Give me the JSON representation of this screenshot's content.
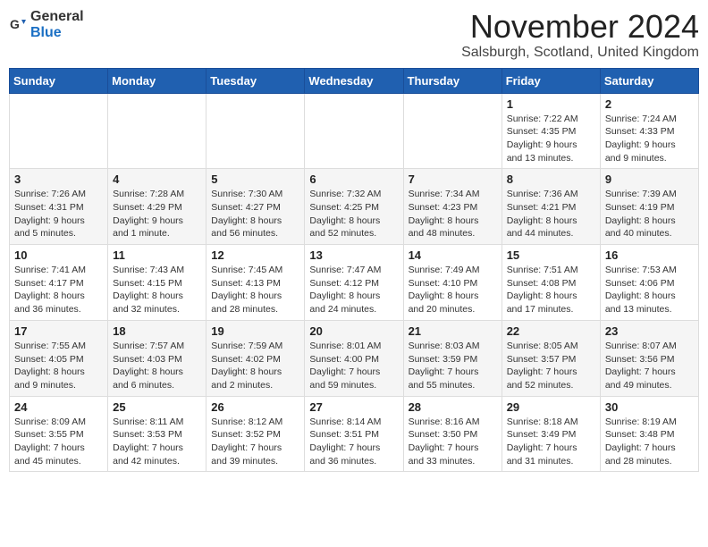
{
  "header": {
    "logo_general": "General",
    "logo_blue": "Blue",
    "month_title": "November 2024",
    "location": "Salsburgh, Scotland, United Kingdom"
  },
  "days_of_week": [
    "Sunday",
    "Monday",
    "Tuesday",
    "Wednesday",
    "Thursday",
    "Friday",
    "Saturday"
  ],
  "weeks": [
    [
      {
        "day": "",
        "info": ""
      },
      {
        "day": "",
        "info": ""
      },
      {
        "day": "",
        "info": ""
      },
      {
        "day": "",
        "info": ""
      },
      {
        "day": "",
        "info": ""
      },
      {
        "day": "1",
        "info": "Sunrise: 7:22 AM\nSunset: 4:35 PM\nDaylight: 9 hours and 13 minutes."
      },
      {
        "day": "2",
        "info": "Sunrise: 7:24 AM\nSunset: 4:33 PM\nDaylight: 9 hours and 9 minutes."
      }
    ],
    [
      {
        "day": "3",
        "info": "Sunrise: 7:26 AM\nSunset: 4:31 PM\nDaylight: 9 hours and 5 minutes."
      },
      {
        "day": "4",
        "info": "Sunrise: 7:28 AM\nSunset: 4:29 PM\nDaylight: 9 hours and 1 minute."
      },
      {
        "day": "5",
        "info": "Sunrise: 7:30 AM\nSunset: 4:27 PM\nDaylight: 8 hours and 56 minutes."
      },
      {
        "day": "6",
        "info": "Sunrise: 7:32 AM\nSunset: 4:25 PM\nDaylight: 8 hours and 52 minutes."
      },
      {
        "day": "7",
        "info": "Sunrise: 7:34 AM\nSunset: 4:23 PM\nDaylight: 8 hours and 48 minutes."
      },
      {
        "day": "8",
        "info": "Sunrise: 7:36 AM\nSunset: 4:21 PM\nDaylight: 8 hours and 44 minutes."
      },
      {
        "day": "9",
        "info": "Sunrise: 7:39 AM\nSunset: 4:19 PM\nDaylight: 8 hours and 40 minutes."
      }
    ],
    [
      {
        "day": "10",
        "info": "Sunrise: 7:41 AM\nSunset: 4:17 PM\nDaylight: 8 hours and 36 minutes."
      },
      {
        "day": "11",
        "info": "Sunrise: 7:43 AM\nSunset: 4:15 PM\nDaylight: 8 hours and 32 minutes."
      },
      {
        "day": "12",
        "info": "Sunrise: 7:45 AM\nSunset: 4:13 PM\nDaylight: 8 hours and 28 minutes."
      },
      {
        "day": "13",
        "info": "Sunrise: 7:47 AM\nSunset: 4:12 PM\nDaylight: 8 hours and 24 minutes."
      },
      {
        "day": "14",
        "info": "Sunrise: 7:49 AM\nSunset: 4:10 PM\nDaylight: 8 hours and 20 minutes."
      },
      {
        "day": "15",
        "info": "Sunrise: 7:51 AM\nSunset: 4:08 PM\nDaylight: 8 hours and 17 minutes."
      },
      {
        "day": "16",
        "info": "Sunrise: 7:53 AM\nSunset: 4:06 PM\nDaylight: 8 hours and 13 minutes."
      }
    ],
    [
      {
        "day": "17",
        "info": "Sunrise: 7:55 AM\nSunset: 4:05 PM\nDaylight: 8 hours and 9 minutes."
      },
      {
        "day": "18",
        "info": "Sunrise: 7:57 AM\nSunset: 4:03 PM\nDaylight: 8 hours and 6 minutes."
      },
      {
        "day": "19",
        "info": "Sunrise: 7:59 AM\nSunset: 4:02 PM\nDaylight: 8 hours and 2 minutes."
      },
      {
        "day": "20",
        "info": "Sunrise: 8:01 AM\nSunset: 4:00 PM\nDaylight: 7 hours and 59 minutes."
      },
      {
        "day": "21",
        "info": "Sunrise: 8:03 AM\nSunset: 3:59 PM\nDaylight: 7 hours and 55 minutes."
      },
      {
        "day": "22",
        "info": "Sunrise: 8:05 AM\nSunset: 3:57 PM\nDaylight: 7 hours and 52 minutes."
      },
      {
        "day": "23",
        "info": "Sunrise: 8:07 AM\nSunset: 3:56 PM\nDaylight: 7 hours and 49 minutes."
      }
    ],
    [
      {
        "day": "24",
        "info": "Sunrise: 8:09 AM\nSunset: 3:55 PM\nDaylight: 7 hours and 45 minutes."
      },
      {
        "day": "25",
        "info": "Sunrise: 8:11 AM\nSunset: 3:53 PM\nDaylight: 7 hours and 42 minutes."
      },
      {
        "day": "26",
        "info": "Sunrise: 8:12 AM\nSunset: 3:52 PM\nDaylight: 7 hours and 39 minutes."
      },
      {
        "day": "27",
        "info": "Sunrise: 8:14 AM\nSunset: 3:51 PM\nDaylight: 7 hours and 36 minutes."
      },
      {
        "day": "28",
        "info": "Sunrise: 8:16 AM\nSunset: 3:50 PM\nDaylight: 7 hours and 33 minutes."
      },
      {
        "day": "29",
        "info": "Sunrise: 8:18 AM\nSunset: 3:49 PM\nDaylight: 7 hours and 31 minutes."
      },
      {
        "day": "30",
        "info": "Sunrise: 8:19 AM\nSunset: 3:48 PM\nDaylight: 7 hours and 28 minutes."
      }
    ]
  ]
}
